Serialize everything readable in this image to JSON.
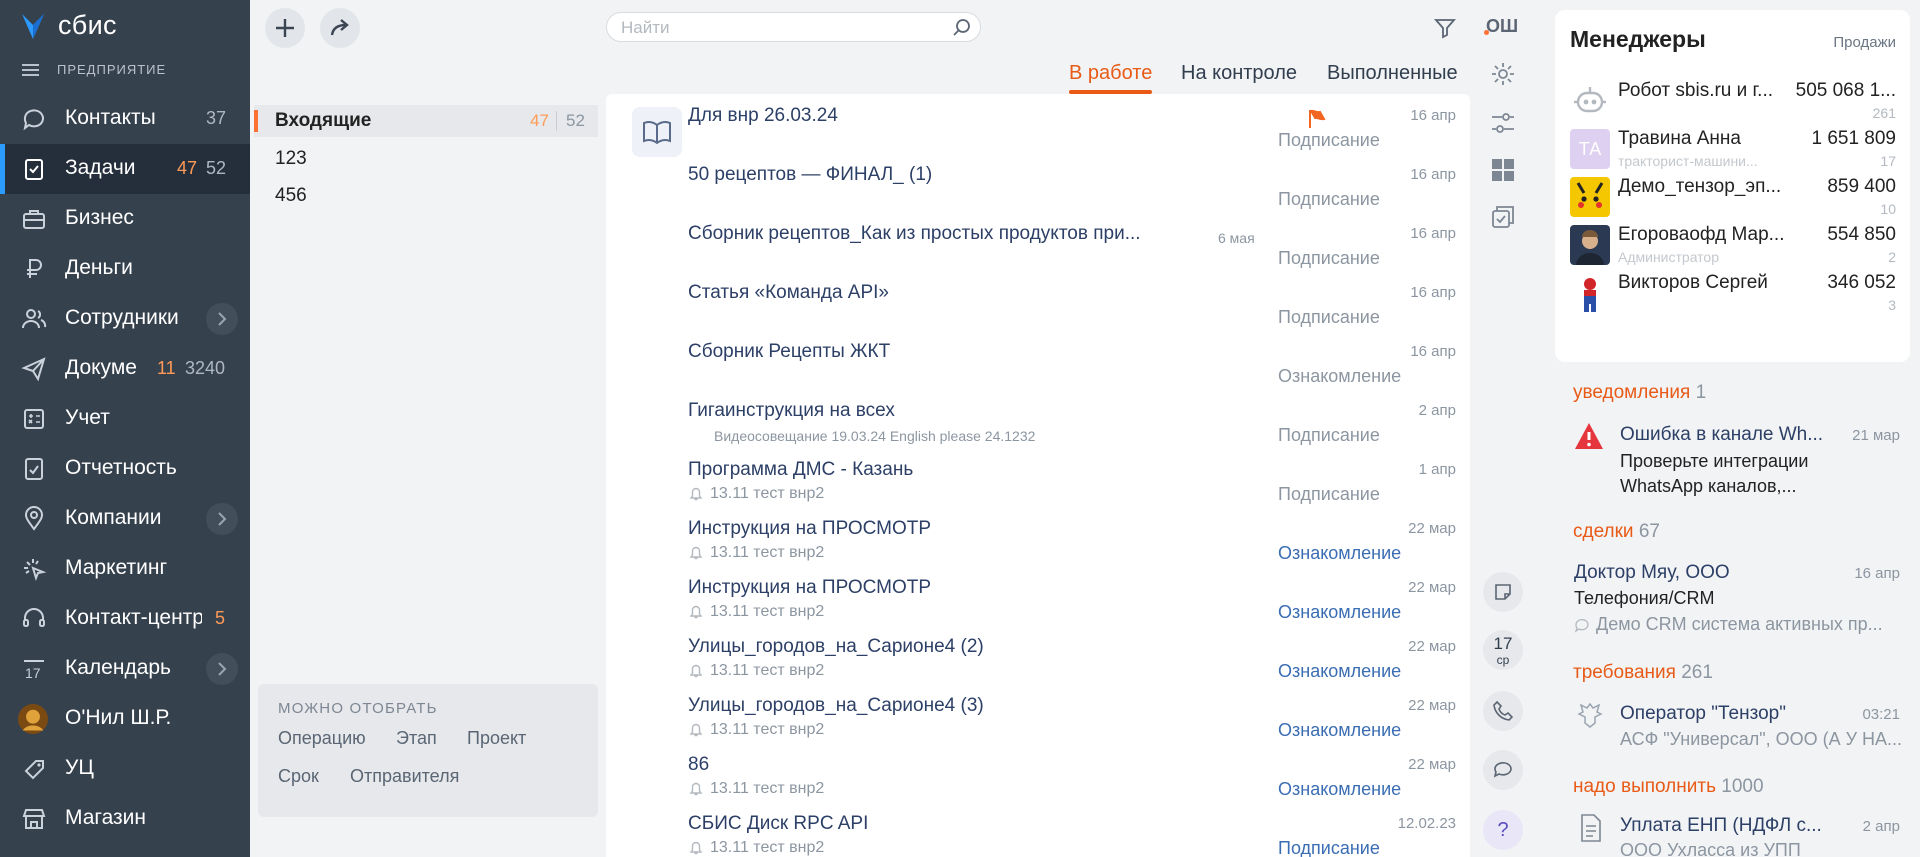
{
  "app": {
    "logo_text": "сбис",
    "org_label": "ПРЕДПРИЯТИЕ"
  },
  "nav": [
    {
      "label": "Контакты",
      "icon": "chat-bubble-icon",
      "count_gray": "37"
    },
    {
      "label": "Задачи",
      "icon": "task-clipboard-icon",
      "count_orange": "47",
      "count_gray": "52",
      "active": true
    },
    {
      "label": "Бизнес",
      "icon": "briefcase-icon"
    },
    {
      "label": "Деньги",
      "icon": "ruble-icon"
    },
    {
      "label": "Сотрудники",
      "icon": "people-icon",
      "chevron": true
    },
    {
      "label": "Докуме",
      "icon": "send-plane-icon",
      "count_orange": "11",
      "count_gray": "3240"
    },
    {
      "label": "Учет",
      "icon": "calculator-icon"
    },
    {
      "label": "Отчетность",
      "icon": "report-icon"
    },
    {
      "label": "Компании",
      "icon": "location-pin-icon",
      "chevron": true
    },
    {
      "label": "Маркетинг",
      "icon": "cursor-click-icon"
    },
    {
      "label": "Контакт-центр",
      "icon": "headset-icon",
      "count_orange": "5"
    },
    {
      "label": "Календарь",
      "icon": "calendar-icon",
      "chevron": true
    },
    {
      "label": "О'Нил Ш.Р.",
      "icon": "user-avatar-icon"
    },
    {
      "label": "УЦ",
      "icon": "certificate-icon"
    },
    {
      "label": "Магазин",
      "icon": "shop-icon"
    }
  ],
  "folders": [
    {
      "label": "Входящие",
      "count_orange": "47",
      "count_gray": "52"
    },
    {
      "label": "123"
    },
    {
      "label": "456"
    }
  ],
  "filter": {
    "title": "МОЖНО ОТОБРАТЬ",
    "options": [
      "Операцию",
      "Этап",
      "Проект",
      "Срок",
      "Отправителя"
    ]
  },
  "search": {
    "placeholder": "Найти"
  },
  "header_user": "ОШ",
  "tabs": [
    "В работе",
    "На контроле",
    "Выполненные"
  ],
  "tasks": [
    {
      "title": "Для внр 26.03.24",
      "sub": "",
      "date": "16 апр",
      "status": "Подписание",
      "blue": false,
      "flag": true
    },
    {
      "title": "50 рецептов — ФИНАЛ_ (1)",
      "sub": "",
      "date": "16 апр",
      "status": "Подписание",
      "blue": false
    },
    {
      "title": "Сборник рецептов_Как из простых продуктов при...",
      "sub": "",
      "extra": "6 мая",
      "date": "16 апр",
      "status": "Подписание",
      "blue": false
    },
    {
      "title": "Статья «Команда API»",
      "sub": "",
      "date": "16 апр",
      "status": "Подписание",
      "blue": false
    },
    {
      "title": "Сборник Рецепты ЖКТ",
      "sub": "",
      "date": "16 апр",
      "status": "Ознакомление",
      "blue": false
    },
    {
      "title": "Гигаинструкция на всех",
      "sub": "Видеосовещание 19.03.24 English please 24.1232",
      "small": true,
      "date": "2 апр",
      "status": "Подписание",
      "blue": false
    },
    {
      "title": "Программа ДМС - Казань",
      "sub": "13.11 тест внр2",
      "bell": true,
      "date": "1 апр",
      "status": "Подписание",
      "blue": false
    },
    {
      "title": "Инструкция на ПРОСМОТР",
      "sub": "13.11 тест внр2",
      "bell": true,
      "date": "22 мар",
      "status": "Ознакомление",
      "blue": true
    },
    {
      "title": "Инструкция на ПРОСМОТР",
      "sub": "13.11 тест внр2",
      "bell": true,
      "date": "22 мар",
      "status": "Ознакомление",
      "blue": true
    },
    {
      "title": "Улицы_городов_на_Сарионе4 (2)",
      "sub": "13.11 тест внр2",
      "bell": true,
      "date": "22 мар",
      "status": "Ознакомление",
      "blue": true
    },
    {
      "title": "Улицы_городов_на_Сарионе4 (3)",
      "sub": "13.11 тест внр2",
      "bell": true,
      "date": "22 мар",
      "status": "Ознакомление",
      "blue": true
    },
    {
      "title": "86",
      "sub": "13.11 тест внр2",
      "bell": true,
      "date": "22 мар",
      "status": "Ознакомление",
      "blue": true
    },
    {
      "title": "СБИС Диск RPC API",
      "sub": "13.11 тест внр2",
      "bell": true,
      "date": "12.02.23",
      "status": "Подписание",
      "blue": true
    }
  ],
  "calendar_widget": {
    "day": "17",
    "weekday": "ср"
  },
  "managers": {
    "title": "Менеджеры",
    "link": "Продажи",
    "list": [
      {
        "name": "Робот sbis.ru и г...",
        "sub": "",
        "value": "505 068 1...",
        "count": "261",
        "avatar": "robot-icon"
      },
      {
        "name": "Травина Анна",
        "sub": "тракторист-машини...",
        "value": "1 651 809",
        "count": "17",
        "avatar": "initials",
        "initials": "ТА"
      },
      {
        "name": "Демо_тензор_эп...",
        "sub": "",
        "value": "859 400",
        "count": "10",
        "avatar": "photo"
      },
      {
        "name": "Егороваофд Мар...",
        "sub": "Администратор",
        "value": "554 850",
        "count": "2",
        "avatar": "photo"
      },
      {
        "name": "Викторов Сергей",
        "sub": "",
        "value": "346 052",
        "count": "3",
        "avatar": "photo"
      }
    ]
  },
  "feed": {
    "notifications": {
      "label": "уведомления",
      "count": "1",
      "title": "Ошибка в канале Wh...",
      "date": "21 мар",
      "line1": "Проверьте интеграции",
      "line2": "WhatsApp каналов,..."
    },
    "deals": {
      "label": "сделки",
      "count": "67",
      "title": "Доктор Мяу, ООО",
      "date": "16 апр",
      "line1": "Телефония/CRM",
      "line2": "Демо CRM система активных пр..."
    },
    "demands": {
      "label": "требования",
      "count": "261",
      "title": "Оператор \"Тензор\"",
      "date": "03:21",
      "line2": "АСФ \"Универсал\", ООО (А У НА..."
    },
    "todo": {
      "label": "надо выполнить",
      "count": "1000",
      "title": "Уплата ЕНП (НДФЛ с...",
      "date": "2 апр",
      "line2": "ООО Ухласса из УПП"
    }
  },
  "colors": {
    "sidebar": "#36414e",
    "accent": "#e85a16",
    "active_nav": "#2c9bff"
  }
}
